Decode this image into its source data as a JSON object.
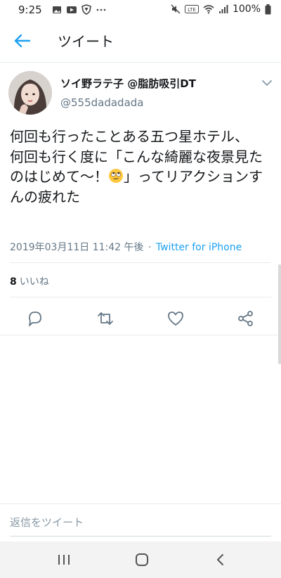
{
  "status_bar": {
    "time": "9:25",
    "battery": "100%"
  },
  "header": {
    "title": "ツイート"
  },
  "tweet": {
    "display_name": "ソイ野ラテ子 @脂肪吸引DT",
    "handle": "@555dadadada",
    "text_before_emoji": "何回も行ったことある五つ星ホテル、\n何回も行く度に「こんな綺麗な夜景見たのはじめて〜！",
    "emoji": "face-with-rolling-eyes",
    "text_after_emoji": "」ってリアクションすんの疲れた",
    "timestamp": "2019年03月11日 11:42 午後",
    "separator": "·",
    "via": "Twitter for iPhone",
    "likes_count": "8",
    "likes_label": "いいね"
  },
  "reply": {
    "placeholder": "返信をツイート"
  },
  "colors": {
    "accent": "#1da1f2",
    "secondary_text": "#657786",
    "text": "#14171a"
  }
}
